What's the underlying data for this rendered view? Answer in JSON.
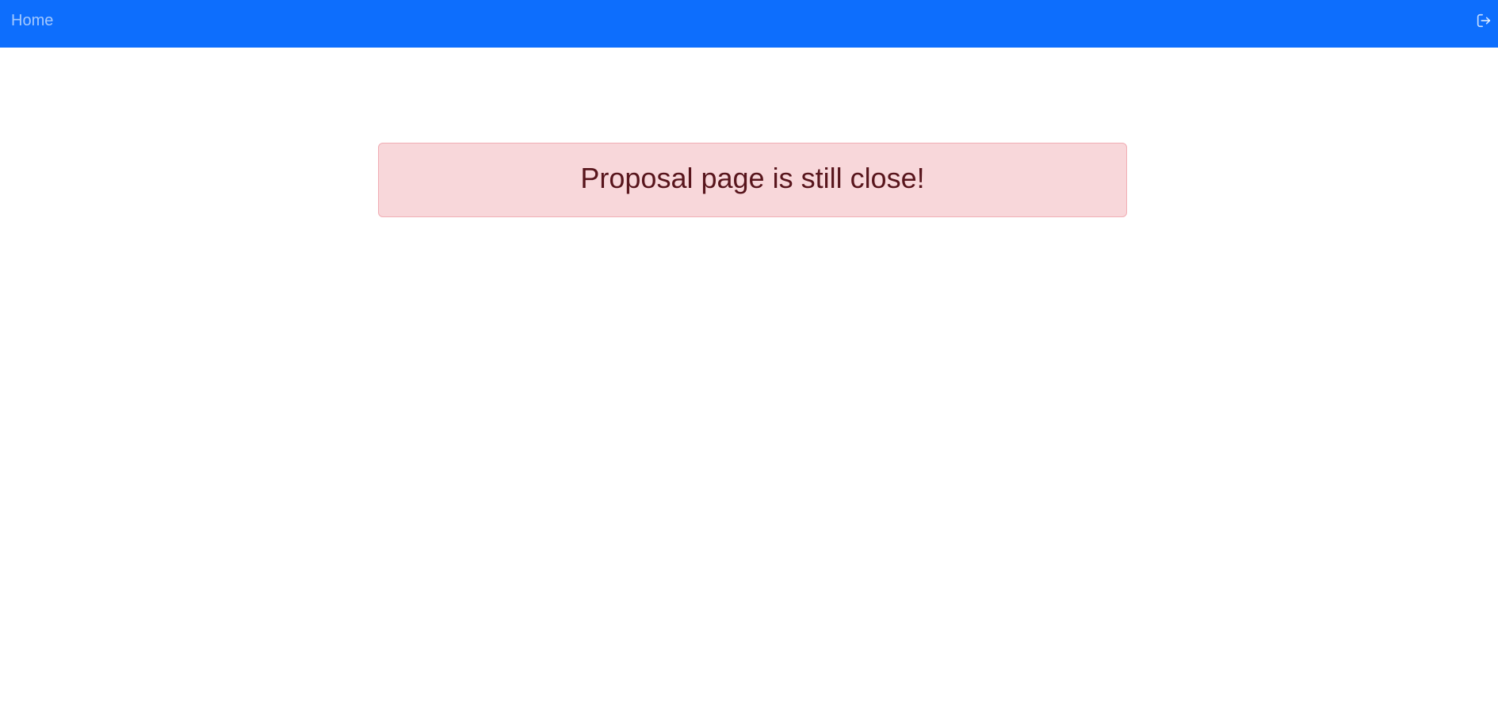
{
  "navbar": {
    "home_label": "Home",
    "logout_icon": "logout-icon",
    "background_color": "#0d6efd"
  },
  "alert": {
    "message": "Proposal page is still close!",
    "background_color": "#f8d7da",
    "border_color": "#f1aeb5",
    "text_color": "#58151c"
  }
}
